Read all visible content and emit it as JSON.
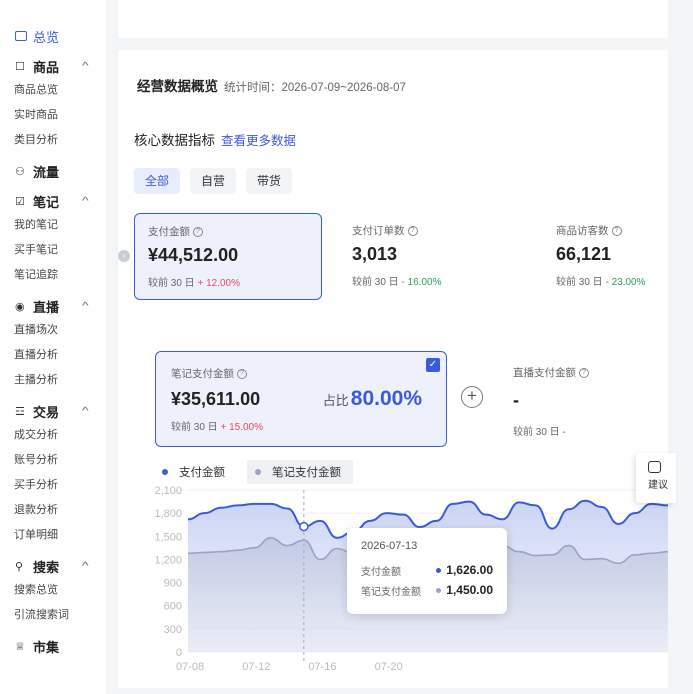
{
  "sidebar": {
    "overview": "总览",
    "groups": [
      {
        "title": "商品",
        "icon": "☐",
        "items": [
          "商品总览",
          "实时商品",
          "类目分析"
        ]
      },
      {
        "title": "流量",
        "icon": "⚇",
        "items": []
      },
      {
        "title": "笔记",
        "icon": "☑",
        "items": [
          "我的笔记",
          "买手笔记",
          "笔记追踪"
        ]
      },
      {
        "title": "直播",
        "icon": "◉",
        "items": [
          "直播场次",
          "直播分析",
          "主播分析"
        ]
      },
      {
        "title": "交易",
        "icon": "☲",
        "items": [
          "成交分析",
          "账号分析",
          "买手分析",
          "退款分析",
          "订单明细"
        ]
      },
      {
        "title": "搜索",
        "icon": "⚲",
        "items": [
          "搜索总览",
          "引流搜索词"
        ]
      },
      {
        "title": "市集",
        "icon": "♕",
        "items": []
      }
    ]
  },
  "header": {
    "title": "经营数据概览",
    "time_label": "统计时间：2026-07-09~2026-08-07"
  },
  "section": {
    "title": "核心数据指标",
    "more": "查看更多数据"
  },
  "tabs": [
    "全部",
    "自营",
    "带货"
  ],
  "metrics": [
    {
      "label": "支付金额",
      "value": "¥44,512.00",
      "cmp": "较前 30 日",
      "delta": "+ 12.00%",
      "dir": "up"
    },
    {
      "label": "支付订单数",
      "value": "3,013",
      "cmp": "较前 30 日",
      "delta": "- 16.00%",
      "dir": "down"
    },
    {
      "label": "商品访客数",
      "value": "66,121",
      "cmp": "较前 30 日",
      "delta": "- 23.00%",
      "dir": "down"
    }
  ],
  "sub_metric": {
    "label": "笔记支付金额",
    "value": "¥35,611.00",
    "ratio_label": "占比",
    "ratio": "80.00%",
    "cmp": "较前 30 日",
    "delta": "+ 15.00%"
  },
  "live_metric": {
    "label": "直播支付金额",
    "value": "-",
    "cmp": "较前 30 日",
    "delta": "-"
  },
  "suggest": "建议",
  "tooltip": {
    "date": "2026-07-13",
    "rows": [
      {
        "label": "支付金额",
        "value": "1,626.00"
      },
      {
        "label": "笔记支付金额",
        "value": "1,450.00"
      }
    ]
  },
  "colors": {
    "primary": "#3a5bd9",
    "secondary": "#9aa3c2",
    "up": "#e84a5f",
    "down": "#26a65b"
  },
  "chart_data": {
    "type": "area",
    "series": [
      {
        "name": "支付金额",
        "values": [
          1720,
          1800,
          1870,
          1900,
          1920,
          1920,
          1860,
          1626,
          1700,
          1480,
          1560,
          1700,
          1800,
          1780,
          1620,
          1700,
          1920,
          1950,
          1780,
          1720,
          1940,
          1900,
          1600,
          1850,
          1960,
          1880,
          1660,
          1800,
          1920,
          1900
        ]
      },
      {
        "name": "笔记支付金额",
        "values": [
          1280,
          1290,
          1300,
          1320,
          1350,
          1480,
          1380,
          1450,
          1200,
          1340,
          1280,
          1290,
          1270,
          1300,
          1260,
          1250,
          1260,
          1250,
          1240,
          1380,
          1300,
          1250,
          1260,
          1380,
          1200,
          1210,
          1150,
          1260,
          1280,
          1300
        ]
      }
    ],
    "yticks": [
      "0",
      "300",
      "600",
      "900",
      "1,200",
      "1,500",
      "1,800",
      "2,100"
    ],
    "ylim": [
      0,
      2100
    ],
    "xticks": [
      "07-08",
      "07-12",
      "07-16",
      "07-20"
    ],
    "highlight_index": 7
  }
}
